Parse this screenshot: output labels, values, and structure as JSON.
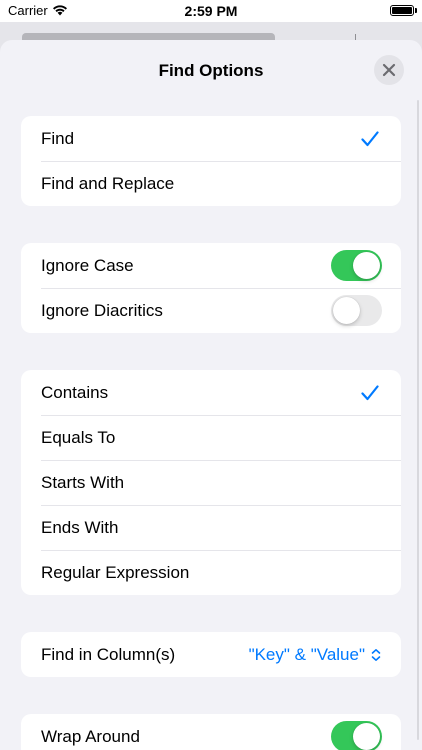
{
  "status_bar": {
    "carrier": "Carrier",
    "time": "2:59 PM"
  },
  "sheet": {
    "title": "Find Options"
  },
  "find_mode": {
    "items": [
      {
        "label": "Find",
        "selected": true
      },
      {
        "label": "Find and Replace",
        "selected": false
      }
    ]
  },
  "case_options": {
    "items": [
      {
        "label": "Ignore Case",
        "on": true
      },
      {
        "label": "Ignore Diacritics",
        "on": false
      }
    ]
  },
  "match_mode": {
    "items": [
      {
        "label": "Contains",
        "selected": true
      },
      {
        "label": "Equals To",
        "selected": false
      },
      {
        "label": "Starts With",
        "selected": false
      },
      {
        "label": "Ends With",
        "selected": false
      },
      {
        "label": "Regular Expression",
        "selected": false
      }
    ]
  },
  "columns": {
    "label": "Find in Column(s)",
    "value": "\"Key\" & \"Value\""
  },
  "wrap": {
    "label": "Wrap Around",
    "on": true
  },
  "colors": {
    "accent": "#007aff",
    "toggle_on": "#34c759",
    "toggle_off": "#e9e9ea",
    "background": "#f2f2f7"
  }
}
